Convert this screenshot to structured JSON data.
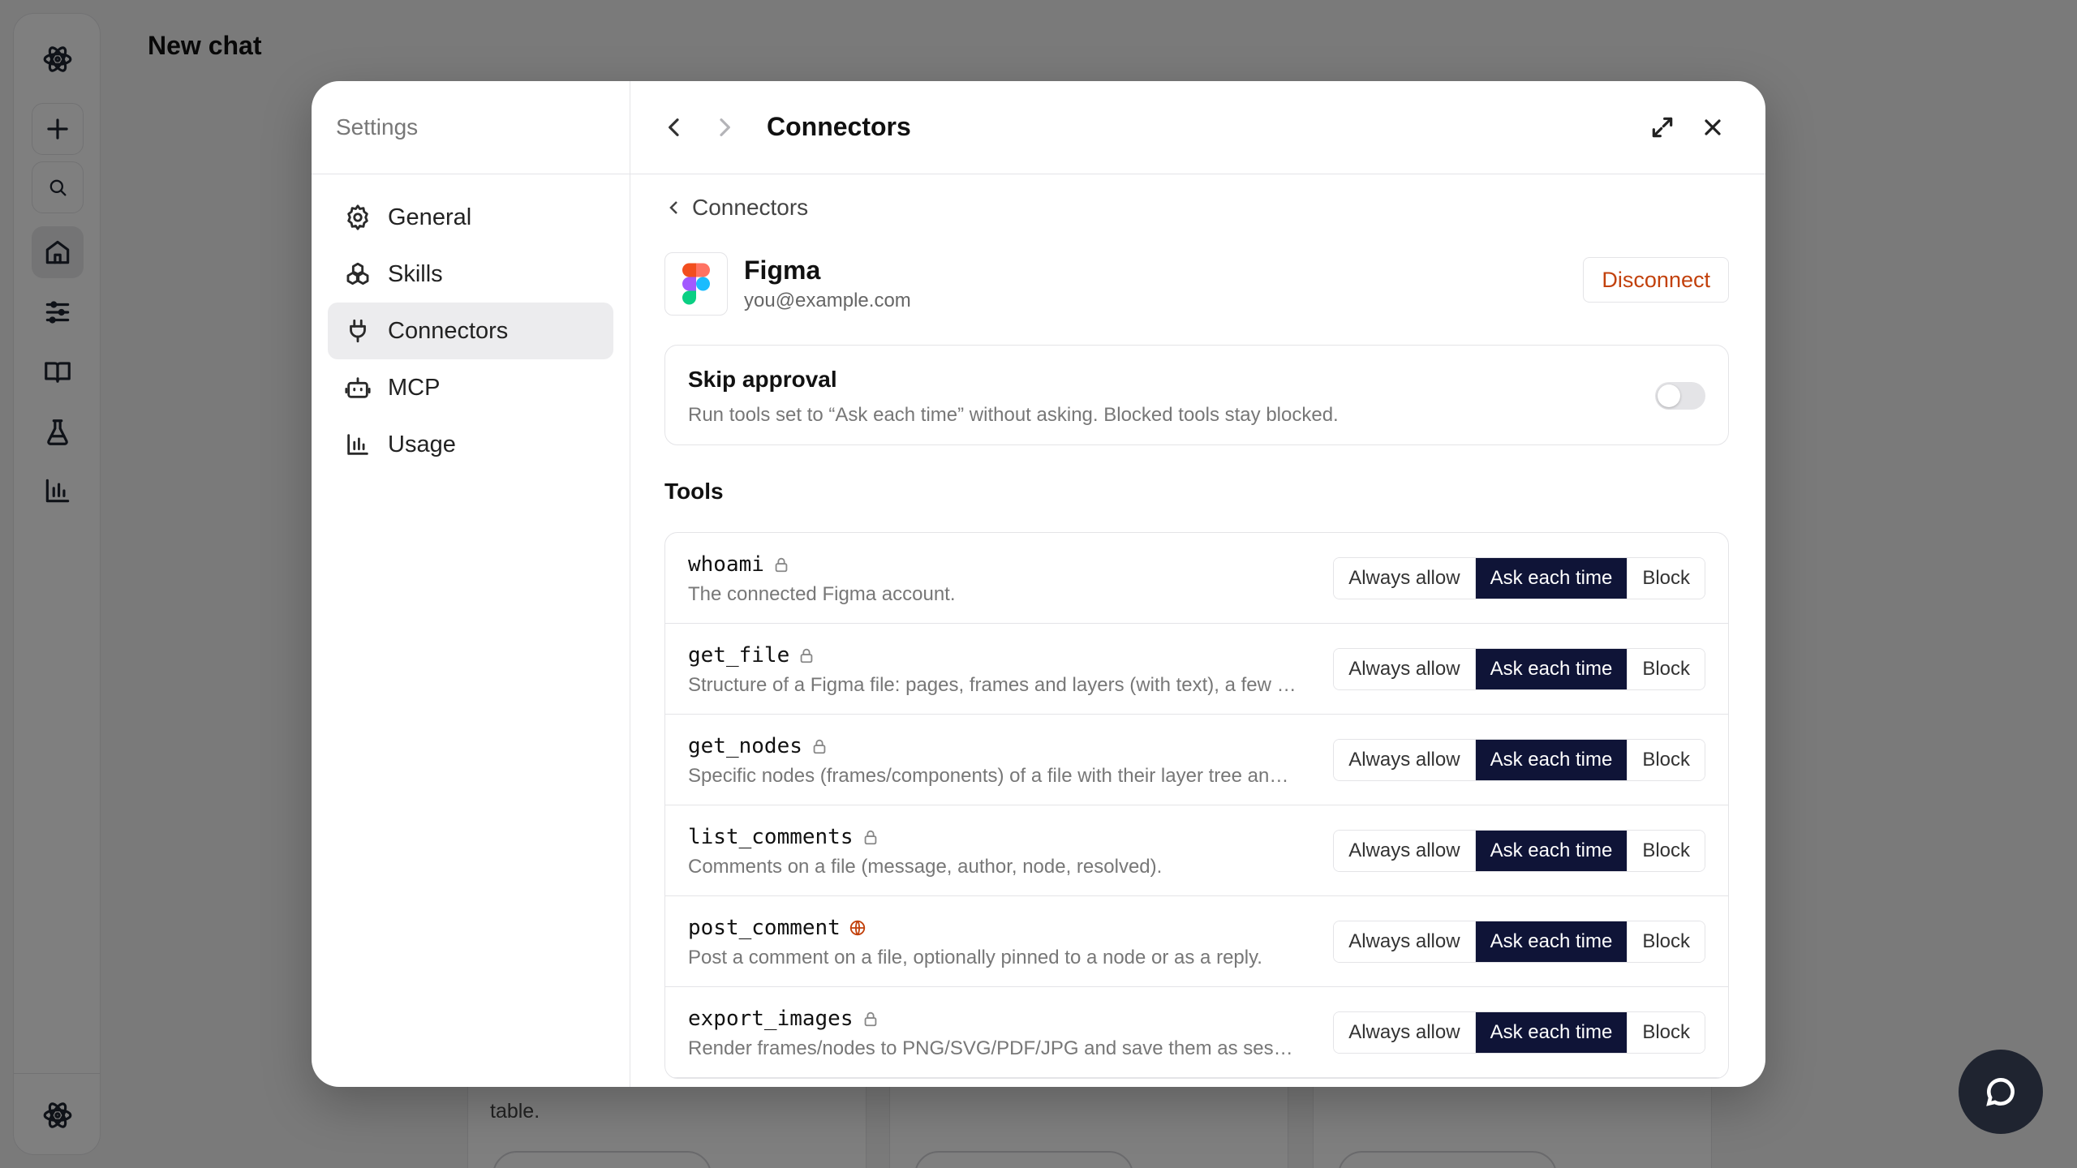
{
  "app": {
    "page_title": "New chat",
    "bg_card_text": "table."
  },
  "settings": {
    "title": "Settings",
    "nav": [
      {
        "label": "General",
        "icon": "gear-icon"
      },
      {
        "label": "Skills",
        "icon": "skills-icon"
      },
      {
        "label": "Connectors",
        "icon": "plug-icon",
        "active": true
      },
      {
        "label": "MCP",
        "icon": "robot-icon"
      },
      {
        "label": "Usage",
        "icon": "bar-chart-icon"
      }
    ]
  },
  "header": {
    "title": "Connectors"
  },
  "connector": {
    "breadcrumb": "Connectors",
    "name": "Figma",
    "email": "you@example.com",
    "disconnect_label": "Disconnect"
  },
  "skip_approval": {
    "title": "Skip approval",
    "description": "Run tools set to “Ask each time” without asking. Blocked tools stay blocked.",
    "enabled": false
  },
  "tools": {
    "heading": "Tools",
    "options": [
      "Always allow",
      "Ask each time",
      "Block"
    ],
    "items": [
      {
        "name": "whoami",
        "icon": "lock-icon",
        "description": "The connected Figma account.",
        "selected": "Ask each time"
      },
      {
        "name": "get_file",
        "icon": "lock-icon",
        "description": "Structure of a Figma file: pages, frames and layers (with text), a few …",
        "selected": "Ask each time"
      },
      {
        "name": "get_nodes",
        "icon": "lock-icon",
        "description": "Specific nodes (frames/components) of a file with their layer tree an…",
        "selected": "Ask each time"
      },
      {
        "name": "list_comments",
        "icon": "lock-icon",
        "description": "Comments on a file (message, author, node, resolved).",
        "selected": "Ask each time"
      },
      {
        "name": "post_comment",
        "icon": "globe-icon",
        "description": "Post a comment on a file, optionally pinned to a node or as a reply.",
        "selected": "Ask each time"
      },
      {
        "name": "export_images",
        "icon": "lock-icon",
        "description": "Render frames/nodes to PNG/SVG/PDF/JPG and save them as ses…",
        "selected": "Ask each time"
      }
    ]
  },
  "colors": {
    "accent": "#0f1437",
    "danger": "#c2410c",
    "globe": "#c2410c"
  }
}
